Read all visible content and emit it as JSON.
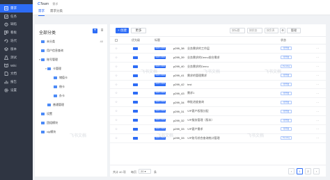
{
  "nav": {
    "items": [
      {
        "label": "需求",
        "icon": "requirement-icon",
        "active": true
      },
      {
        "label": "任务",
        "icon": "task-icon"
      },
      {
        "label": "缺陷",
        "icon": "bug-icon"
      },
      {
        "label": "看板",
        "icon": "board-icon"
      },
      {
        "label": "迭代",
        "icon": "iteration-icon"
      },
      {
        "label": "版本",
        "icon": "version-icon"
      },
      {
        "label": "测试",
        "icon": "test-icon"
      },
      {
        "label": "Wiki",
        "icon": "wiki-icon"
      },
      {
        "label": "文档",
        "icon": "document-icon"
      },
      {
        "label": "报告",
        "icon": "report-icon"
      },
      {
        "label": "设置",
        "icon": "settings-icon"
      }
    ]
  },
  "header": {
    "logo_prefix": "C",
    "logo_name": "Team",
    "project": "需求",
    "tabs": [
      {
        "label": "需求",
        "active": true
      },
      {
        "label": "需求分类",
        "active": false
      }
    ]
  },
  "category": {
    "title": "全部分类",
    "add_label": "+",
    "more_label": "≡",
    "nodes": [
      {
        "label": "未分类",
        "count": "40",
        "level": 0,
        "caret": "",
        "selected": false
      },
      {
        "label": "用户信息查询",
        "count": "",
        "level": 0,
        "caret": "",
        "selected": false
      },
      {
        "label": "账号管理",
        "count": "",
        "level": 0,
        "caret": "▾",
        "selected": false
      },
      {
        "label": "卡管理",
        "count": "",
        "level": 1,
        "caret": "▾",
        "selected": false
      },
      {
        "label": "储值卡",
        "count": "",
        "level": 2,
        "caret": "",
        "selected": false
      },
      {
        "label": "借卡",
        "count": "",
        "level": 2,
        "caret": "",
        "selected": false
      },
      {
        "label": "办卡",
        "count": "",
        "level": 2,
        "caret": "",
        "selected": false
      },
      {
        "label": "普通管理",
        "count": "",
        "level": 1,
        "caret": "",
        "selected": false
      },
      {
        "label": "设置",
        "count": "",
        "level": 0,
        "caret": "",
        "selected": false
      },
      {
        "label": "团组模块",
        "count": "",
        "level": 0,
        "caret": "",
        "selected": false
      },
      {
        "label": "vip模块",
        "count": "",
        "level": 0,
        "caret": "",
        "selected": false
      }
    ]
  },
  "toolbar": {
    "add_label": "+ 创建",
    "more_label": "更多",
    "filters": [
      "按标题",
      "按状态",
      "按负责"
    ],
    "manage_label": "管理"
  },
  "table": {
    "columns": [
      "",
      "优先级",
      "标题",
      "",
      "",
      "状态"
    ],
    "col_pri": "优先级",
    "col_title": "标题",
    "col_status": "状态",
    "code_prefix": "CEFO-0000",
    "rows": [
      {
        "id": "p299_38",
        "title": "业务需求的工作层",
        "status": "待开发"
      },
      {
        "id": "p299_39",
        "title": "业务需求的Demo前台需求",
        "status": "待开发"
      },
      {
        "id": "p299_40",
        "title": "业务需求的Demo",
        "status": "Pending"
      },
      {
        "id": "p299_41",
        "title": "需求的管理需求",
        "status": "待开发"
      },
      {
        "id": "p299_42",
        "title": "test",
        "status": "待开发"
      },
      {
        "id": "p299_43",
        "title": "需求1",
        "status": "待开发"
      },
      {
        "id": "p299_34",
        "title": "审批进度查询",
        "status": "待开发"
      },
      {
        "id": "p299_31",
        "title": "VIP客户权限分配",
        "status": "待开发"
      },
      {
        "id": "p299_32",
        "title": "VIP服务管理（版本）",
        "status": "待开发"
      },
      {
        "id": "p299_33",
        "title": "VIP客户需求",
        "status": "待开发"
      },
      {
        "id": "p299_33",
        "title": "VIP账号综合查询统计管理",
        "status": "Pending"
      }
    ]
  },
  "pagination": {
    "total": "共计 40 项",
    "size_label": "每页",
    "size": "20",
    "unit": "条",
    "pages": [
      "1",
      "2"
    ],
    "prev": "‹",
    "next": "›"
  },
  "watermark": "飞书文档"
}
